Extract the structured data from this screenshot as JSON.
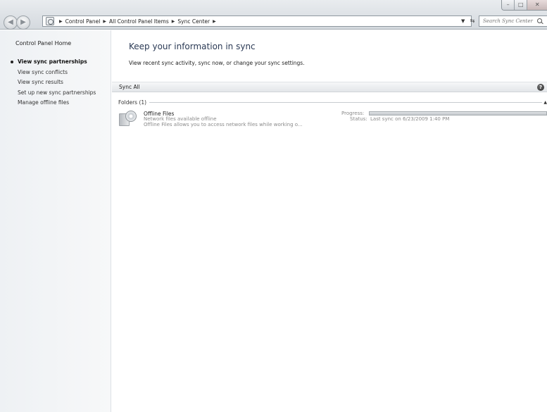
{
  "window": {
    "buttons": {
      "minimize": "–",
      "maximize": "□",
      "close": "✕"
    }
  },
  "address": {
    "crumbs": [
      "Control Panel",
      "All Control Panel Items",
      "Sync Center"
    ],
    "search_placeholder": "Search Sync Center"
  },
  "sidebar": {
    "home": "Control Panel Home",
    "items": [
      {
        "label": "View sync partnerships",
        "active": true
      },
      {
        "label": "View sync conflicts"
      },
      {
        "label": "View sync results"
      },
      {
        "label": "Set up new sync partnerships"
      },
      {
        "label": "Manage offline files"
      }
    ]
  },
  "main": {
    "title": "Keep your information in sync",
    "description": "View recent sync activity, sync now, or change your sync settings.",
    "toolbar": {
      "sync_all": "Sync All",
      "help": "?"
    },
    "group": {
      "label": "Folders (1)"
    },
    "item": {
      "title": "Offline Files",
      "subtitle": "Network files available offline",
      "detail": "Offline Files allows you to access network files while working o...",
      "progress_label": "Progress:",
      "progress": 1.0,
      "status_label": "Status:",
      "status_value": "Last sync on 6/23/2009 1:40 PM"
    }
  }
}
